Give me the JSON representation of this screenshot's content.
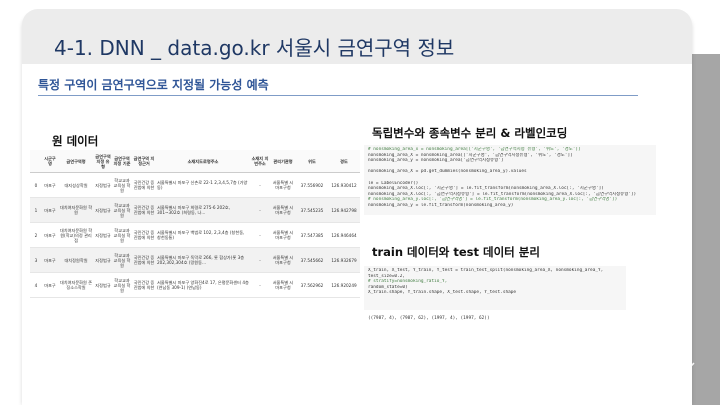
{
  "slide": {
    "title": "4-1. DNN _ data.go.kr 서울시 금연구역 정보",
    "subtitle": "특정 구역이 금연구역으로 지정될 가능성 예측",
    "nav_arrow": "↓"
  },
  "raw_data": {
    "label": "원 데이터",
    "columns": [
      "",
      "시군구명",
      "금연구역명",
      "금연구역 지정 유형",
      "금연구역 지정 기준",
      "금연구역 지정근거",
      "소재지도로명주소",
      "소재지 지번주소",
      "관리기관명",
      "위도",
      "경도"
    ],
    "rows": [
      [
        "0",
        "마포구",
        "대지성상학원",
        "지정법규",
        "학교교과 교육실 학원",
        "국민건강 증진법에 의한",
        "서울특별시 마포구 신촌로 22-1 2,3,4,5,7층 (가양동)",
        "-",
        "서울특별 시 마포구청",
        "37.556902",
        "126.930412"
      ],
      [
        "1",
        "마포구",
        "대치여자문화원 학원",
        "지정법규",
        "학교교과 교육실 학원",
        "국민건강 증진법에 의한",
        "서울특별시 마포구 희령로 275-6 202호, 301~302호 (희령동, 나...",
        "-",
        "서울특별 시 마포구청",
        "37.545235",
        "126.942798"
      ],
      [
        "2",
        "마포구",
        "대치여자문화원 학원(학교)의정 관리점",
        "지정법규",
        "학교교과 교육실 학원",
        "국민건강 증진법에 의한",
        "서울특별시 마포구 백범로 102, 2,3,4층 (창천동, 창천동통)",
        "-",
        "서울특별 시 마포구청",
        "37.547385",
        "126.946464"
      ],
      [
        "3",
        "마포구",
        "대치정원학원",
        "지정법규",
        "학교교과 교육실 학원",
        "국민건강 증진법에 의한",
        "서울특별시 마포구 독막로 266, 롯 합상가(롯 3층 202,302,304호 (망원동...",
        "-",
        "서울특별 시 마포구청",
        "37.545662",
        "126.932679"
      ],
      [
        "4",
        "마포구",
        "대치여자문화원 존징소스학원",
        "지정법규",
        "학교교과 교육실 학원",
        "국민건강 증진법에 의한",
        "서울특별시 마포구 양화진4로 17, 은평문화센터 4층(연남동 309-1) (연남동)",
        "-",
        "서울특별 시 마포구청",
        "37.562962",
        "126.920249"
      ]
    ]
  },
  "encoding": {
    "label": "독립변수와 종속변수 분리 & 라벨인코딩",
    "code_lines": [
      "# nonsmoking_area_x = nonsmoking_area[['시군구명', '금연구역지정 유형', '위도', '경도']]",
      "nonsmoking_area_X = nonsmoking_area[['시군구명', '금연구역지정유형', '위도', '경도']]",
      "nonsmoking_area_y = nonsmoking_area['금연구역지정유형']",
      "",
      "nonsmoking_area_X = pd.get_dummies(nonsmoking_area_y).values",
      "",
      "le = LabelEncoder()",
      "nonsmoking_area_X.loc[:, '시군구명'] = le.fit_transform(nonsmoking_area_X.loc[:, '시군구명'])",
      "nonsmoking_area_X.loc[:, '금연구역지정유형'] = le.fit_transform(nonsmoking_area_X.loc[:, '금연구역지정유형'])",
      "# nonsmoking_area_y.loc[:, '금연구역명'] = le.fit_transform(nonsmoking_area_y.loc[:, '금연구역명'])",
      "nonsmoking_area_y = le.fit_transform(nonsmoking_area_y)"
    ]
  },
  "split": {
    "label": "train 데이터와 test 데이터 분리",
    "code_lines": [
      "X_train, X_test, Y_train, Y_test = train_test_split(nonsmoking_area_X, nonsmoking_area_Y,",
      "                                                    test_size=0.2,",
      "                                                    # stratify=nonsmoking_ratio_Y,",
      "                                                    random_state=0)",
      "X_train.shape, Y_train.shape, X_test.shape, Y_test.shape"
    ],
    "output": "((7987, 4), (7987, 62), (1997, 4), (1997, 62))"
  }
}
